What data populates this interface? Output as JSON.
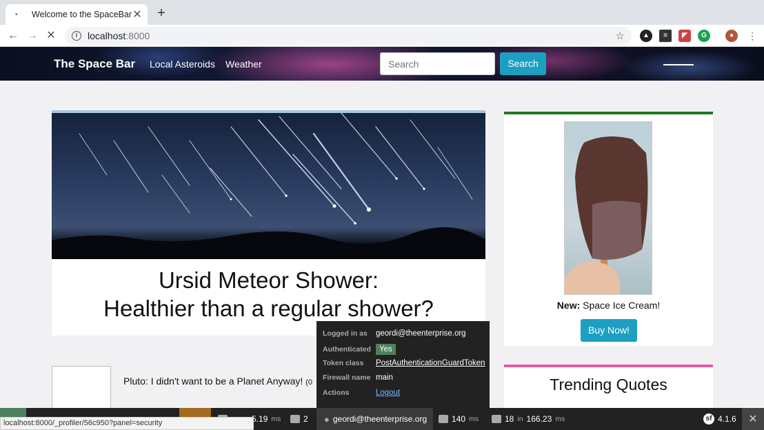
{
  "browser": {
    "tab_title": "Welcome to the SpaceBar",
    "url_host": "localhost",
    "url_port": ":8000",
    "status_url": "localhost:8000/_profiler/56c950?panel=security"
  },
  "navbar": {
    "brand": "The Space Bar",
    "links": [
      "Local Asteroids",
      "Weather"
    ],
    "search_placeholder": "Search",
    "search_button": "Search"
  },
  "article": {
    "title_line1": "Ursid Meteor Shower:",
    "title_line2": "Healthier than a regular shower?"
  },
  "ad": {
    "label_bold": "New:",
    "label_text": "Space Ice Cream!",
    "button": "Buy Now!"
  },
  "news": {
    "title": "Pluto: I didn't want to be a Planet Anyway!",
    "count_fragment": "(0"
  },
  "quotes": {
    "title": "Trending Quotes"
  },
  "security_panel": {
    "rows": [
      {
        "label": "Logged in as",
        "value": "geordi@theenterprise.org"
      },
      {
        "label": "Authenticated",
        "value": "Yes"
      },
      {
        "label": "Token class",
        "value": "PostAuthenticationGuardToken"
      },
      {
        "label": "Firewall name",
        "value": "main"
      },
      {
        "label": "Actions",
        "value": "Logout"
      }
    ]
  },
  "profiler": {
    "perf_time": "5.19",
    "perf_unit": "ms",
    "translation_count": "2",
    "user": "geordi@theenterprise.org",
    "twig_time": "140",
    "twig_unit": "ms",
    "db_queries": "18",
    "db_in": "in",
    "db_time": "166.23",
    "db_unit": "ms",
    "symfony_version": "4.1.6"
  },
  "colors": {
    "accent": "#1d9fc2",
    "ad_border": "#1e7a1e",
    "quotes_border": "#e05da3",
    "article_border": "#a8c6e0",
    "yes_badge": "#4f805d",
    "profiler_bg": "#222222"
  }
}
